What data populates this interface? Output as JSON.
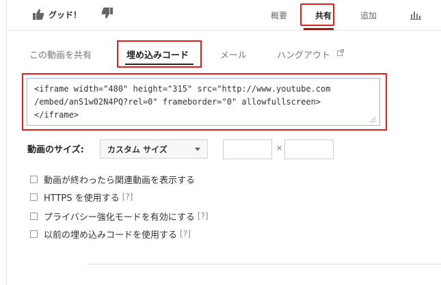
{
  "topbar": {
    "like_label": "グッド！",
    "tabs": {
      "overview": "概要",
      "share": "共有",
      "add": "追加"
    }
  },
  "share_tabs": {
    "share_video": "この動画を共有",
    "embed": "埋め込みコード",
    "email": "メール",
    "hangout": "ハングアウト"
  },
  "embed_code": "<iframe width=\"480\" height=\"315\" src=\"http://www.youtube.com\n/embed/anS1w02N4PQ?rel=0\" frameborder=\"0\" allowfullscreen>\n</iframe>",
  "size": {
    "label": "動画のサイズ:",
    "selected": "カスタム サイズ",
    "width_value": "",
    "height_value": "",
    "times": "×"
  },
  "options": [
    {
      "label": "動画が終わったら関連動画を表示する",
      "help": ""
    },
    {
      "label": "HTTPS を使用する",
      "help": "[?]"
    },
    {
      "label": "プライバシー強化モードを有効にする",
      "help": "[?]"
    },
    {
      "label": "以前の埋め込みコードを使用する",
      "help": "[?]"
    }
  ],
  "colors": {
    "highlight": "#e02020",
    "active_underline": "#b31217"
  }
}
